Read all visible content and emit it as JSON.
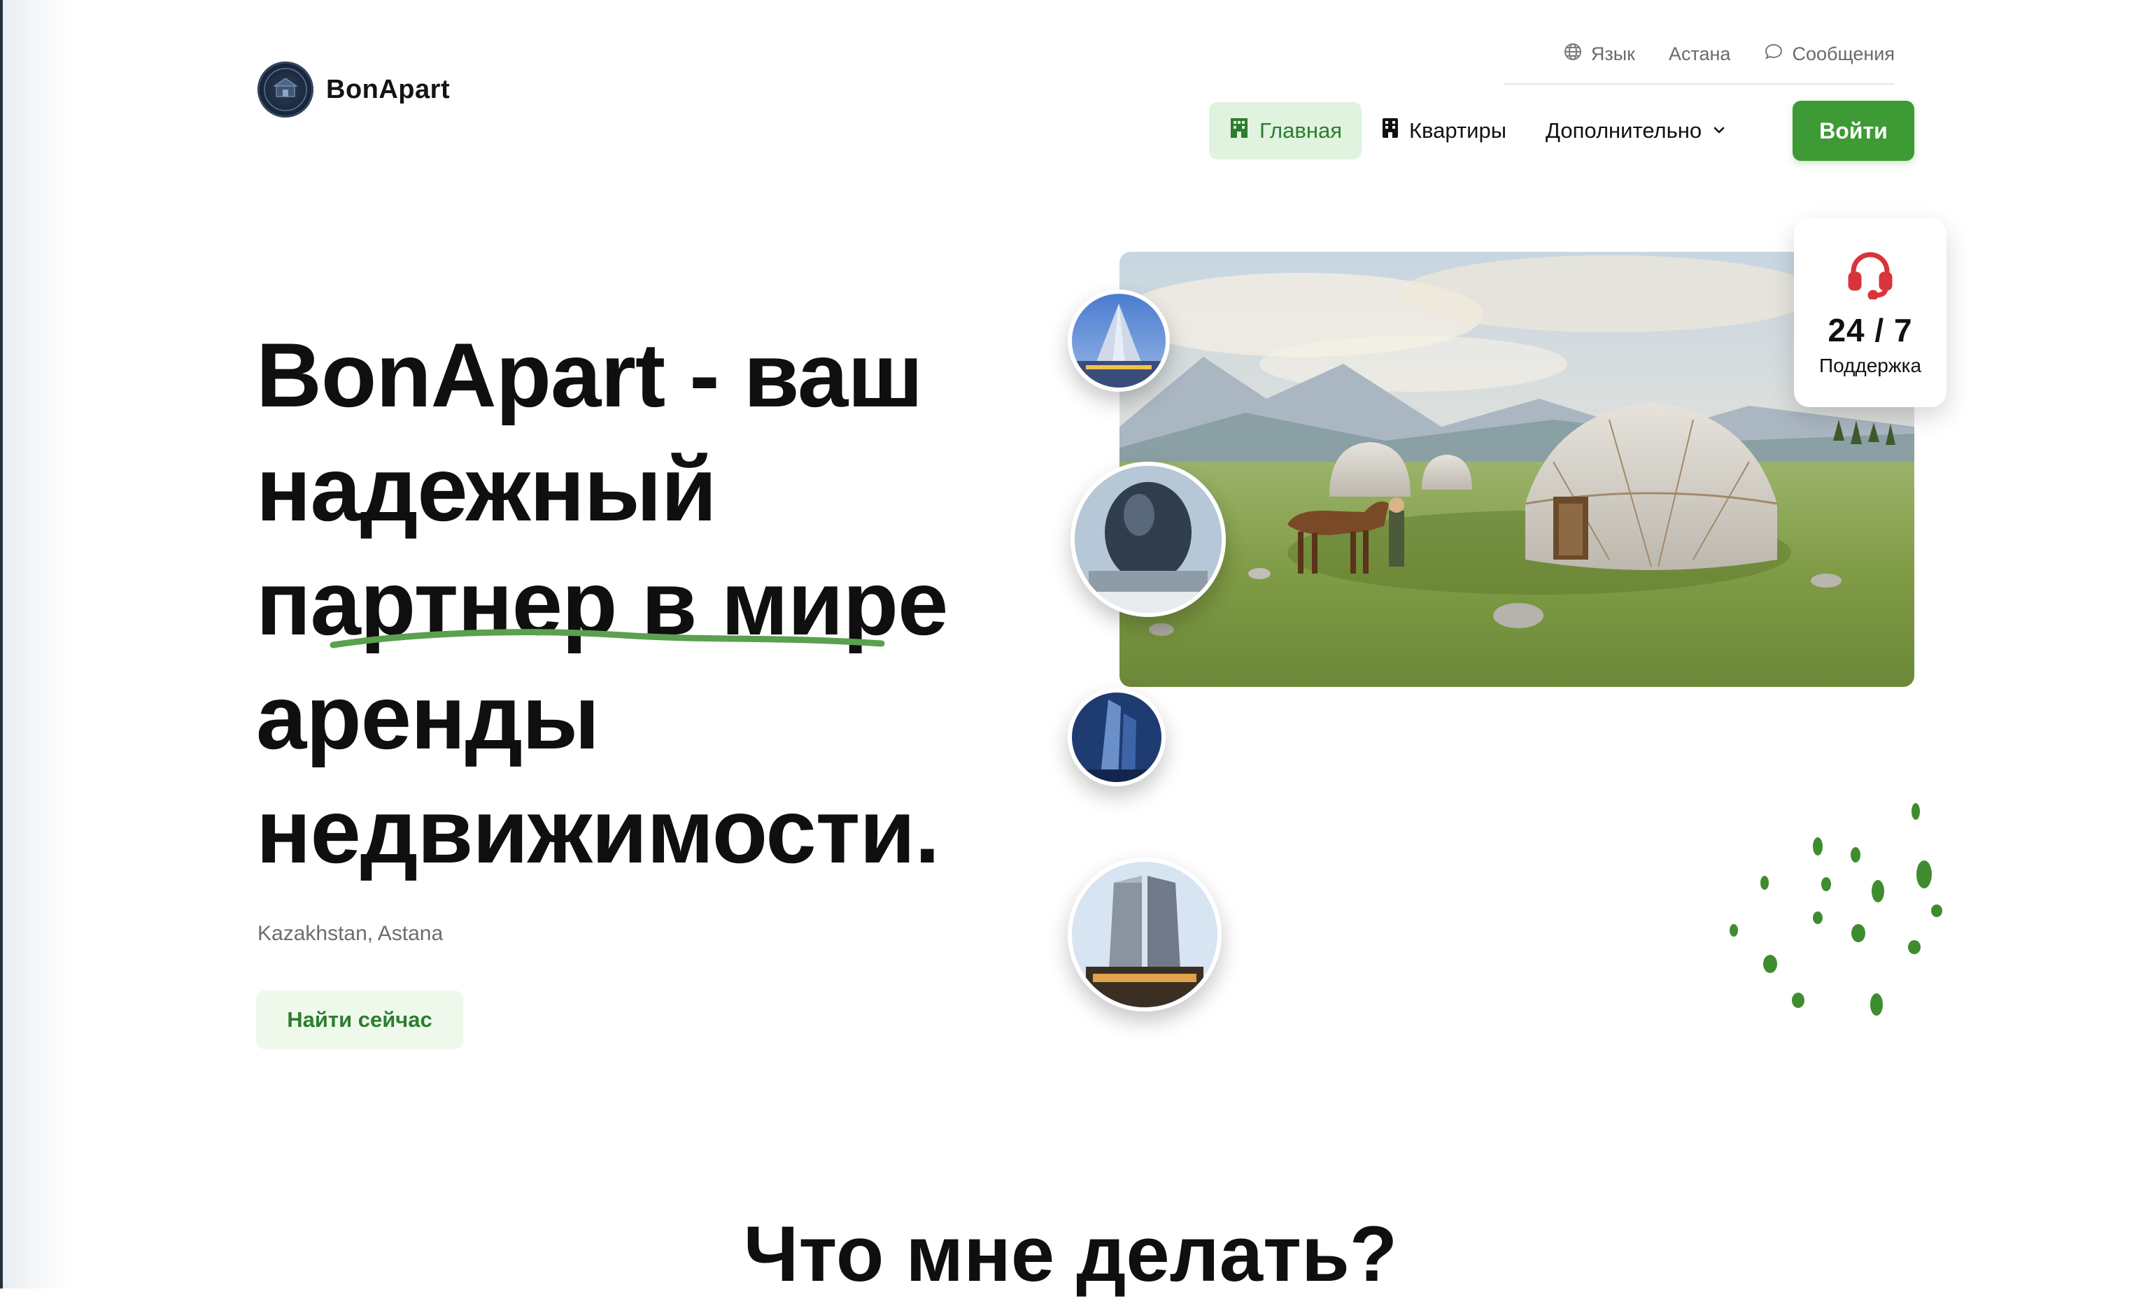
{
  "brand": {
    "name": "BonApart"
  },
  "utility": {
    "language": "Язык",
    "city": "Астана",
    "messages": "Сообщения"
  },
  "nav": {
    "home": "Главная",
    "apartments": "Квартиры",
    "more": "Дополнительно",
    "login": "Войти"
  },
  "hero": {
    "title_line1": "BonApart - ваш",
    "title_line2": "надежный",
    "title_line3": "партнер в мире",
    "title_line4": "аренды",
    "title_line5": "недвижимости.",
    "location": "Kazakhstan, Astana",
    "cta": "Найти сейчас"
  },
  "support": {
    "value": "24 / 7",
    "label": "Поддержка"
  },
  "section": {
    "title": "Что мне делать?"
  },
  "icons": {
    "language": "globe-icon",
    "messages": "chat-bubble-icon",
    "home": "building-icon",
    "apartments": "office-building-icon",
    "more": "chevron-down-icon",
    "support": "headset-icon"
  },
  "colors": {
    "primary": "#3e9a35",
    "primary_light": "#dff3de",
    "cta_bg": "#eef9ec",
    "text": "#0f0f0f",
    "muted": "#6d6d6d",
    "support_icon": "#d8343a"
  }
}
